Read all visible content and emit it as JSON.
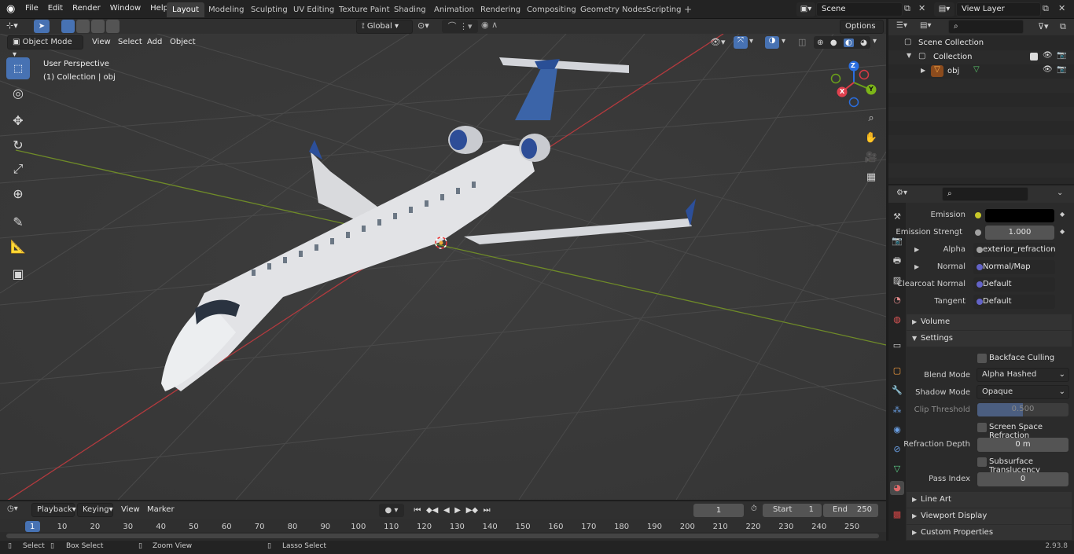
{
  "menus": [
    "File",
    "Edit",
    "Render",
    "Window",
    "Help"
  ],
  "workspaces": [
    {
      "label": "Layout",
      "active": true
    },
    {
      "label": "Modeling"
    },
    {
      "label": "Sculpting"
    },
    {
      "label": "UV Editing"
    },
    {
      "label": "Texture Paint"
    },
    {
      "label": "Shading"
    },
    {
      "label": "Animation"
    },
    {
      "label": "Rendering"
    },
    {
      "label": "Compositing"
    },
    {
      "label": "Geometry Nodes"
    },
    {
      "label": "Scripting"
    }
  ],
  "scene_name": "Scene",
  "view_layer": "View Layer",
  "viewport_header": {
    "mode": "Object Mode",
    "menus": [
      "View",
      "Select",
      "Add",
      "Object"
    ],
    "orientation": "Global",
    "options": "Options"
  },
  "viewport": {
    "perspective": "User Perspective",
    "collection_info": "(1) Collection | obj",
    "gizmo_axes": {
      "z": "Z",
      "y": "Y",
      "x": "X"
    }
  },
  "outliner": {
    "items": [
      {
        "label": "Scene Collection",
        "icon": "scene-collection-icon"
      },
      {
        "label": "Collection",
        "icon": "collection-icon"
      },
      {
        "label": "obj",
        "icon": "mesh-object-icon"
      }
    ]
  },
  "properties": {
    "rows": [
      {
        "label": "Emission",
        "value": "",
        "kind": "color"
      },
      {
        "label": "Emission Strengt",
        "value": "1.000",
        "kind": "number"
      },
      {
        "label": "Alpha",
        "value": "exterior_refraction_i...",
        "kind": "link"
      },
      {
        "label": "Normal",
        "value": "Normal/Map",
        "kind": "link"
      },
      {
        "label": "Clearcoat Normal",
        "value": "Default",
        "kind": "link"
      },
      {
        "label": "Tangent",
        "value": "Default",
        "kind": "link"
      }
    ],
    "sections": {
      "volume": "Volume",
      "settings": "Settings",
      "line_art": "Line Art",
      "viewport_display": "Viewport Display",
      "custom_properties": "Custom Properties"
    },
    "settings": {
      "backface_culling": "Backface Culling",
      "blend_mode_label": "Blend Mode",
      "blend_mode": "Alpha Hashed",
      "shadow_mode_label": "Shadow Mode",
      "shadow_mode": "Opaque",
      "clip_threshold_label": "Clip Threshold",
      "clip_threshold": "0.500",
      "ssr": "Screen Space Refraction",
      "refraction_depth_label": "Refraction Depth",
      "refraction_depth": "0 m",
      "subsurface": "Subsurface Translucency",
      "pass_index_label": "Pass Index",
      "pass_index": "0"
    },
    "colors": {
      "emission": "#000000",
      "accent": "#4772b3"
    }
  },
  "timeline": {
    "menus": [
      "Playback",
      "Keying",
      "View",
      "Marker"
    ],
    "current_frame": "1",
    "start_label": "Start",
    "start": "1",
    "end_label": "End",
    "end": "250",
    "ticks": [
      "1",
      "10",
      "20",
      "30",
      "40",
      "50",
      "60",
      "70",
      "80",
      "90",
      "100",
      "110",
      "120",
      "130",
      "140",
      "150",
      "160",
      "170",
      "180",
      "190",
      "200",
      "210",
      "220",
      "230",
      "240",
      "250"
    ]
  },
  "statusbar": {
    "select": "Select",
    "box_select": "Box Select",
    "zoom_view": "Zoom View",
    "lasso_select": "Lasso Select",
    "version": "2.93.8"
  }
}
